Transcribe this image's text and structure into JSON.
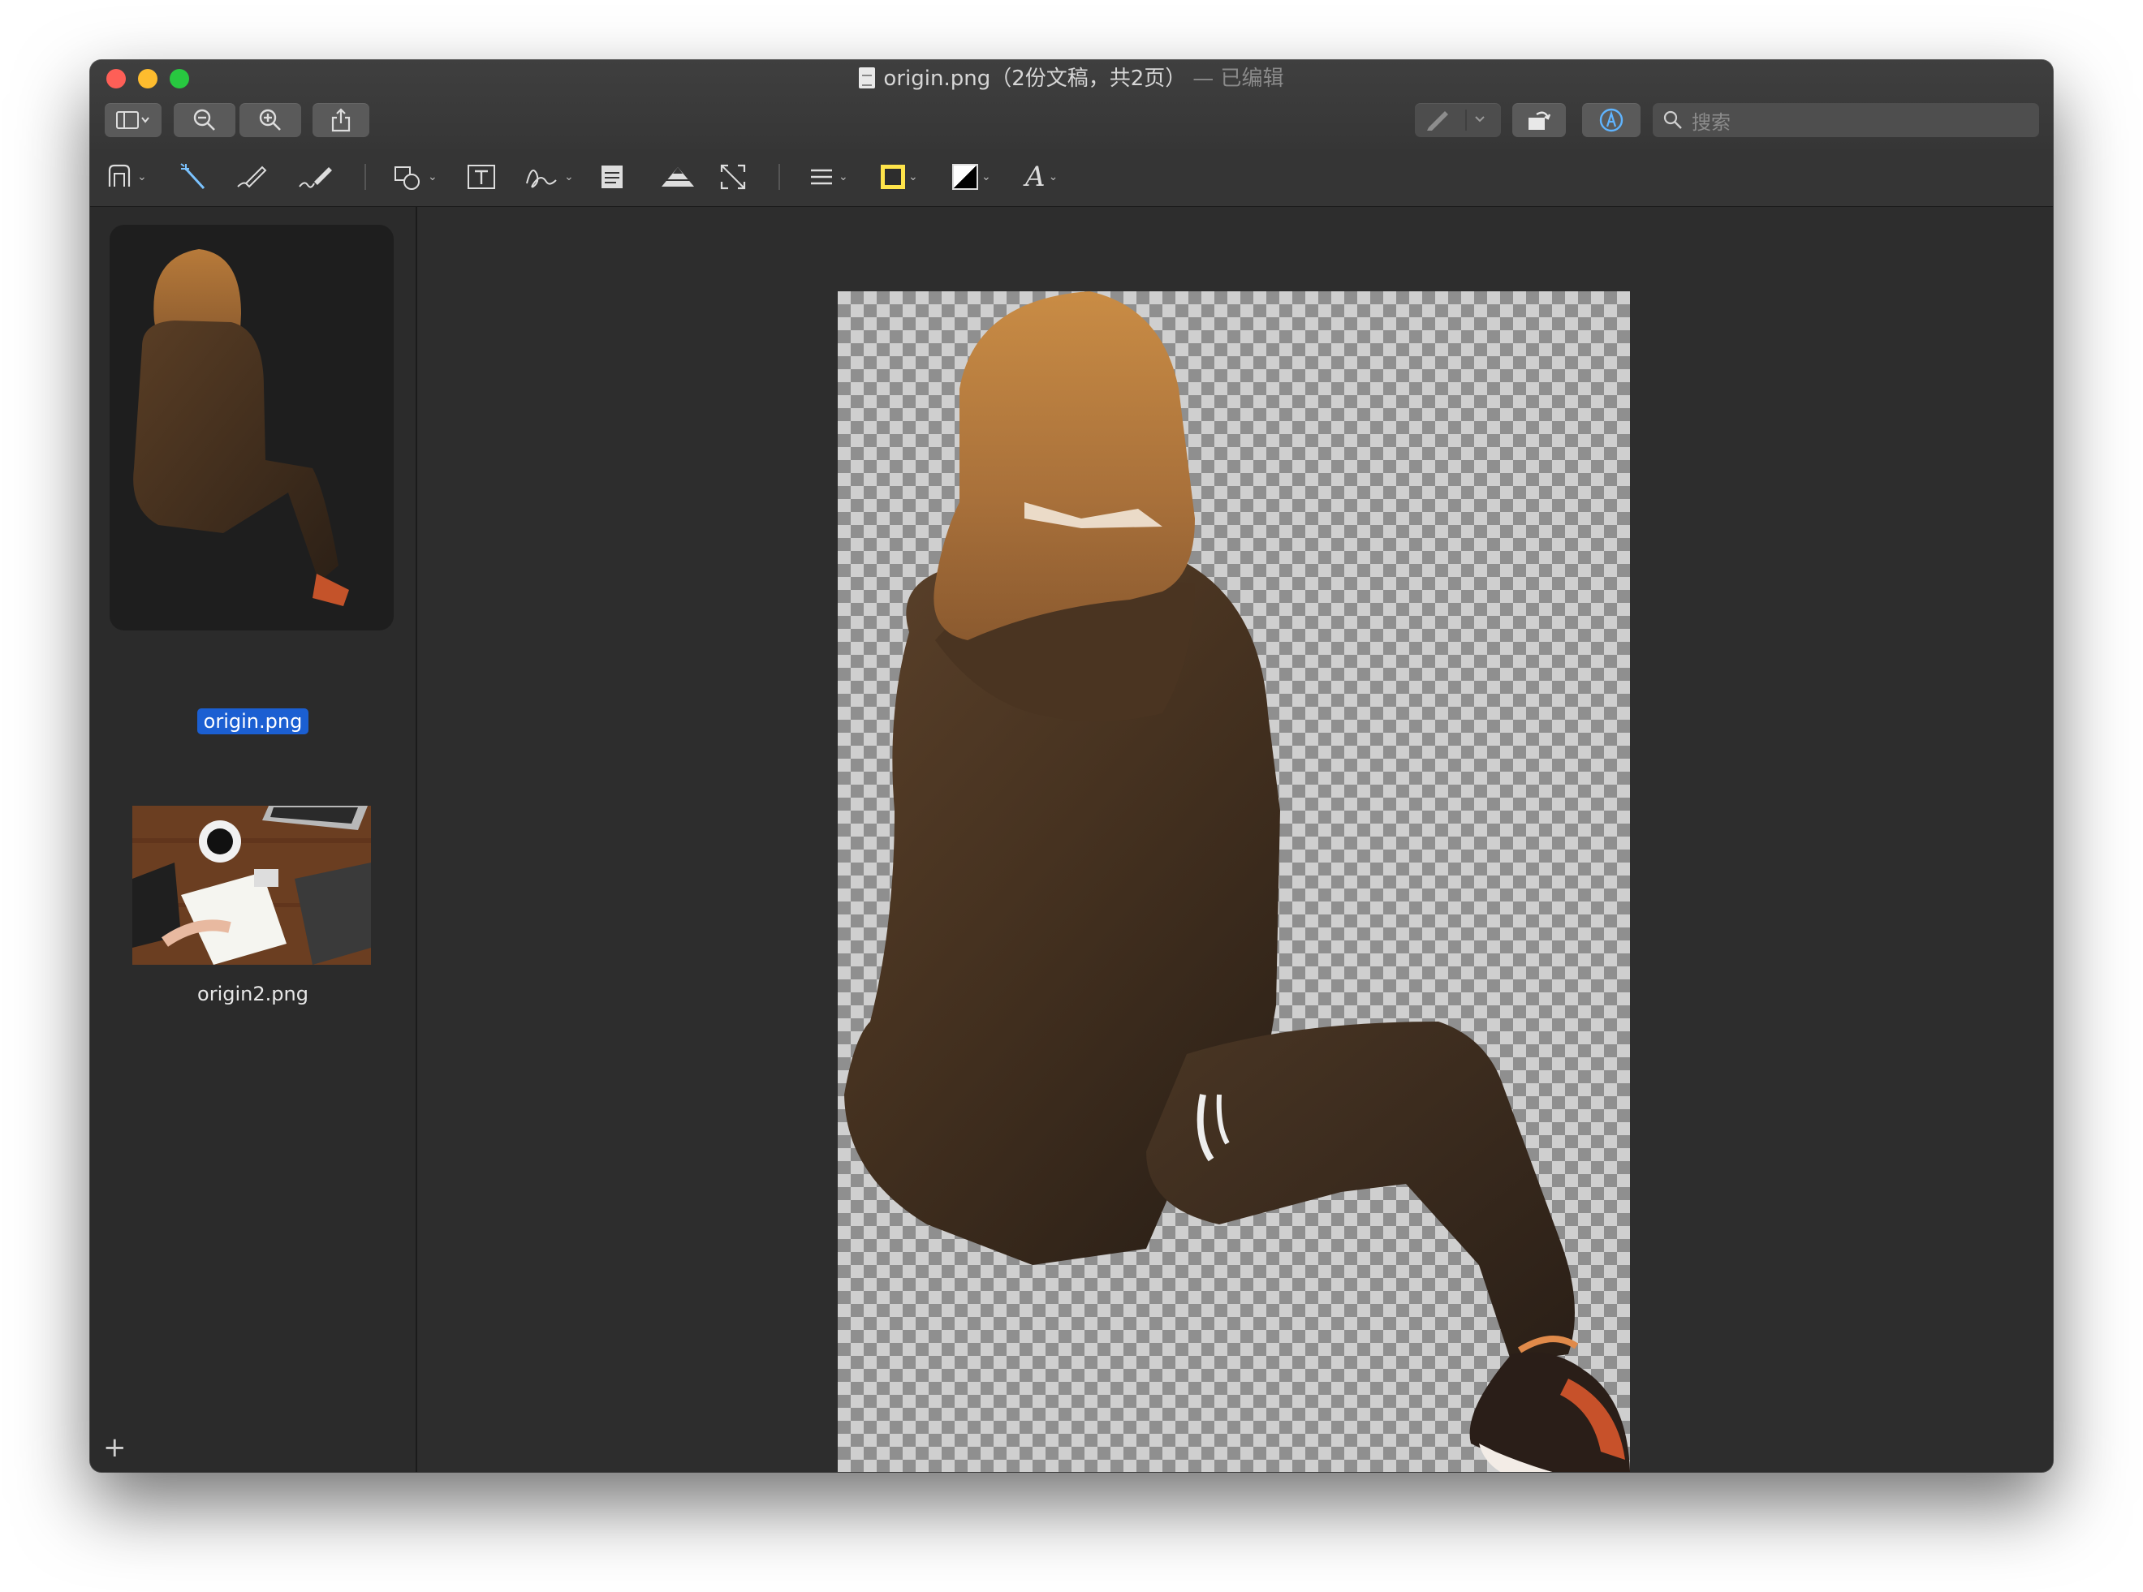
{
  "window": {
    "title": "origin.png（2份文稿，共2页）",
    "edited_suffix": "— 已编辑"
  },
  "toolbar": {
    "sidebar_toggle_icon": "sidebar-icon",
    "zoom_out_icon": "zoom-out-icon",
    "zoom_in_icon": "zoom-in-icon",
    "share_icon": "share-icon",
    "markup_pen_icon": "pen-icon",
    "rotate_icon": "rotate-icon",
    "markup_toggle_icon": "markup-icon",
    "search_placeholder": "搜索"
  },
  "markup_tools": [
    "instant-alpha-icon",
    "magic-wand-icon",
    "sketch-icon",
    "draw-icon",
    "shapes-icon",
    "text-box-icon",
    "signature-icon",
    "note-icon",
    "adjust-color-icon",
    "resize-icon",
    "line-style-icon",
    "border-color-icon",
    "fill-color-icon",
    "text-style-icon"
  ],
  "colors": {
    "border_color": "#ffe44a",
    "selection": "#1b5fd2",
    "window_bg": "#2d2d2d"
  },
  "sidebar": {
    "items": [
      {
        "label": "origin.png",
        "selected": true
      },
      {
        "label": "origin2.png",
        "selected": false
      }
    ],
    "add_label": "+"
  }
}
